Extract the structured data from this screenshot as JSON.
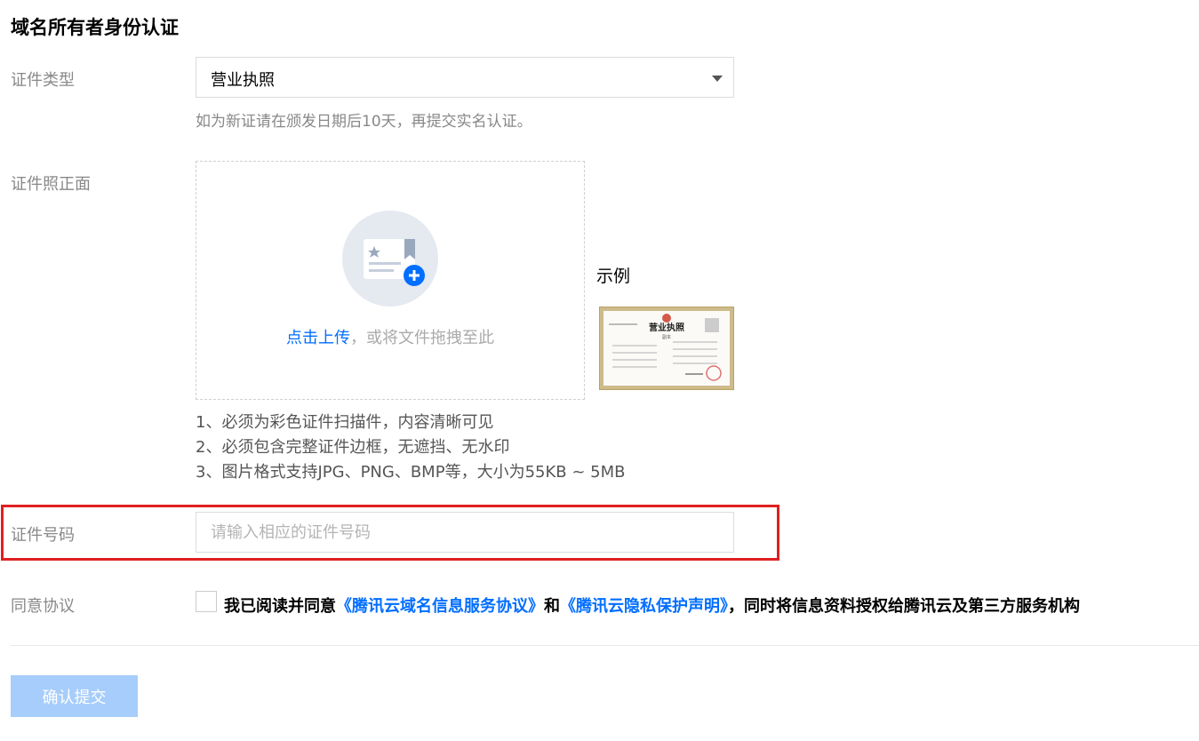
{
  "section": {
    "title": "域名所有者身份认证"
  },
  "cert_type": {
    "label": "证件类型",
    "selected": "营业执照",
    "hint": "如为新证请在颁发日期后10天，再提交实名认证。"
  },
  "cert_front": {
    "label": "证件照正面",
    "upload_link": "点击上传",
    "upload_text": "，或将文件拖拽至此",
    "example_label": "示例",
    "example_image": {
      "heading": "营业执照",
      "sub": "副本"
    },
    "requirements": [
      "1、必须为彩色证件扫描件，内容清晰可见",
      "2、必须包含完整证件边框，无遮挡、无水印",
      "3、图片格式支持JPG、PNG、BMP等，大小为55KB ~ 5MB"
    ]
  },
  "cert_number": {
    "label": "证件号码",
    "placeholder": "请输入相应的证件号码",
    "value": ""
  },
  "agreement": {
    "label": "同意协议",
    "prefix": "我已阅读并同意",
    "link1": "《腾讯云域名信息服务协议》",
    "and": "和",
    "link2": "《腾讯云隐私保护声明》",
    "suffix": "，同时将信息资料授权给腾讯云及第三方服务机构",
    "checked": false
  },
  "submit": {
    "label": "确认提交"
  },
  "colors": {
    "link": "#006eff",
    "submit_disabled": "#a6cdfb",
    "highlight": "#e02020",
    "label": "#888888"
  }
}
